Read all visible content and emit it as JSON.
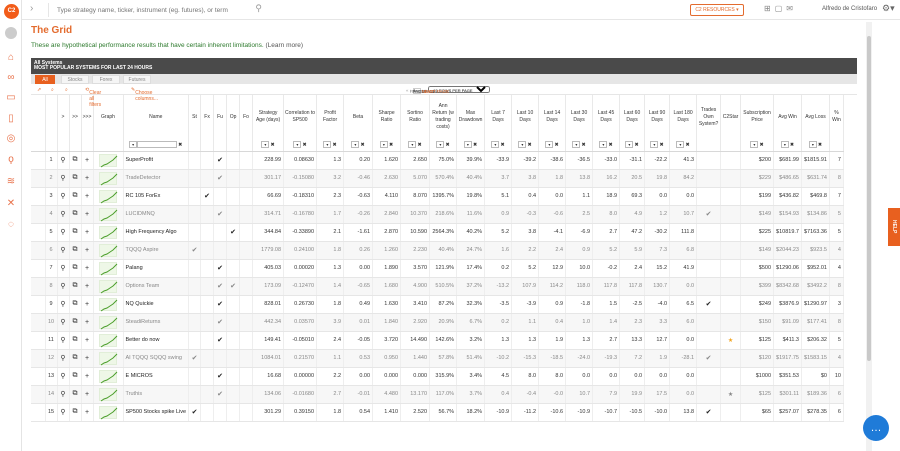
{
  "topbar": {
    "search_placeholder": "Type strategy name, ticker, instrument (eg. futures), or term",
    "resources_label": "C2 RESOURCES",
    "user_name": "Alfredo de Cristofaro"
  },
  "page": {
    "title": "The Grid",
    "disclaimer": "These are hypothetical performance results that have certain inherent limitations.",
    "learn_more": "(Learn more)"
  },
  "panel": {
    "title_line1": "All Systems",
    "title_line2": "MOST POPULAR SYSTEMS FOR LAST 24 HOURS"
  },
  "tabs": [
    "All",
    "Stocks",
    "Forex",
    "Futures"
  ],
  "toolbar": {
    "clear_filters": "Clear all filters",
    "choose_columns": "Choose columns...",
    "first_page": "FIRST PAGE",
    "previous": "PREVIOUS",
    "page_label": "PAGE",
    "page_value": "1",
    "of_pages": "OF 33",
    "next": "NEXT",
    "last_page": "LAST PAGE",
    "rows_per_page": "15 ROWS PER PAGE"
  },
  "columns": [
    "",
    ">",
    ">>",
    ">>>",
    "Graph",
    "Name",
    "St",
    "Fx",
    "Fu",
    "Op",
    "Fo",
    "Strategy Age (days)",
    "Correlation to SP500",
    "Profit Factor",
    "Beta",
    "Sharpe Ratio",
    "Sortino Ratio",
    "Ann Return (w trading costs)",
    "Max Drawdown",
    "Last 7 Days",
    "Last 10 Days",
    "Last 14 Days",
    "Last 30 Days",
    "Last 45 Days",
    "Last 60 Days",
    "Last 90 Days",
    "Last 180 Days",
    "Trades Own System?",
    "C2Star",
    "Subscription Price",
    "Avg Win",
    "Avg Loss",
    "% Win"
  ],
  "rows": [
    {
      "n": "1",
      "name": "SuperProfit",
      "st": "",
      "fx": "",
      "fu": "✔",
      "op": "",
      "fo": "",
      "age": "228.99",
      "corr": "0.08630",
      "pf": "1.3",
      "beta": "0.20",
      "sharpe": "1.620",
      "sortino": "2.650",
      "ann": "75.0%",
      "dd": "39.9%",
      "d7": "-33.9",
      "d10": "-39.2",
      "d14": "-38.6",
      "d30": "-36.5",
      "d45": "-33.0",
      "d60": "-31.1",
      "d90": "-22.2",
      "d180": "41.3",
      "own": "",
      "star": "",
      "price": "$200",
      "win": "$681.99",
      "loss": "$1815.91",
      "pw": "7",
      "muted": false
    },
    {
      "n": "2",
      "name": "TradeDetector",
      "st": "",
      "fx": "",
      "fu": "✔",
      "op": "",
      "fo": "",
      "age": "301.17",
      "corr": "-0.15080",
      "pf": "3.2",
      "beta": "-0.46",
      "sharpe": "2.630",
      "sortino": "5.070",
      "ann": "570.4%",
      "dd": "40.4%",
      "d7": "3.7",
      "d10": "3.8",
      "d14": "1.8",
      "d30": "13.8",
      "d45": "16.2",
      "d60": "20.5",
      "d90": "19.8",
      "d180": "84.2",
      "own": "",
      "star": "",
      "price": "$229",
      "win": "$486.65",
      "loss": "$631.74",
      "pw": "8",
      "muted": true
    },
    {
      "n": "3",
      "name": "RC 105 ForEx",
      "st": "",
      "fx": "✔",
      "op": "",
      "fu": "",
      "fo": "",
      "age": "66.69",
      "corr": "-0.18310",
      "pf": "2.3",
      "beta": "-0.63",
      "sharpe": "4.110",
      "sortino": "8.070",
      "ann": "1395.7%",
      "dd": "19.8%",
      "d7": "5.1",
      "d10": "0.4",
      "d14": "0.0",
      "d30": "1.1",
      "d45": "18.9",
      "d60": "69.3",
      "d90": "0.0",
      "d180": "0.0",
      "own": "",
      "star": "",
      "price": "$199",
      "win": "$436.82",
      "loss": "$469.8",
      "pw": "7",
      "muted": false
    },
    {
      "n": "4",
      "name": "LUCIDMNQ",
      "st": "",
      "fx": "",
      "fu": "✔",
      "op": "",
      "fo": "",
      "age": "314.71",
      "corr": "-0.16780",
      "pf": "1.7",
      "beta": "-0.26",
      "sharpe": "2.840",
      "sortino": "10.370",
      "ann": "218.6%",
      "dd": "11.6%",
      "d7": "0.9",
      "d10": "-0.3",
      "d14": "-0.6",
      "d30": "2.5",
      "d45": "8.0",
      "d60": "4.9",
      "d90": "1.2",
      "d180": "10.7",
      "own": "✔",
      "star": "",
      "price": "$149",
      "win": "$154.93",
      "loss": "$134.86",
      "pw": "5",
      "muted": true
    },
    {
      "n": "5",
      "name": "High Frequency Algo",
      "st": "",
      "fx": "",
      "fu": "",
      "op": "✔",
      "fo": "",
      "age": "344.84",
      "corr": "-0.33890",
      "pf": "2.1",
      "beta": "-1.61",
      "sharpe": "2.870",
      "sortino": "10.590",
      "ann": "2564.3%",
      "dd": "40.2%",
      "d7": "5.2",
      "d10": "3.8",
      "d14": "-4.1",
      "d30": "-6.9",
      "d45": "2.7",
      "d60": "47.2",
      "d90": "-30.2",
      "d180": "111.8",
      "own": "",
      "star": "",
      "price": "$225",
      "win": "$10819.7",
      "loss": "$7163.36",
      "pw": "5",
      "muted": false
    },
    {
      "n": "6",
      "name": "TQQQ Aspire",
      "st": "✔",
      "fx": "",
      "fu": "",
      "op": "",
      "fo": "",
      "age": "1779.08",
      "corr": "0.24100",
      "pf": "1.8",
      "beta": "0.26",
      "sharpe": "1.260",
      "sortino": "2.230",
      "ann": "40.4%",
      "dd": "24.7%",
      "d7": "1.6",
      "d10": "2.2",
      "d14": "2.4",
      "d30": "0.9",
      "d45": "5.2",
      "d60": "5.9",
      "d90": "7.3",
      "d180": "6.8",
      "own": "",
      "star": "",
      "price": "$149",
      "win": "$2044.23",
      "loss": "$923.5",
      "pw": "4",
      "muted": true
    },
    {
      "n": "7",
      "name": "Palang",
      "st": "",
      "fx": "",
      "fu": "✔",
      "op": "",
      "fo": "",
      "age": "405.03",
      "corr": "0.00020",
      "pf": "1.3",
      "beta": "0.00",
      "sharpe": "1.890",
      "sortino": "3.570",
      "ann": "121.9%",
      "dd": "17.4%",
      "d7": "0.2",
      "d10": "5.2",
      "d14": "12.9",
      "d30": "10.0",
      "d45": "-0.2",
      "d60": "2.4",
      "d90": "15.2",
      "d180": "41.9",
      "own": "",
      "star": "",
      "price": "$500",
      "win": "$1290.06",
      "loss": "$952.01",
      "pw": "4",
      "muted": false
    },
    {
      "n": "8",
      "name": "Options Team",
      "st": "",
      "fx": "",
      "fu": "✔",
      "op": "✔",
      "fo": "",
      "age": "173.09",
      "corr": "-0.12470",
      "pf": "1.4",
      "beta": "-0.65",
      "sharpe": "1.680",
      "sortino": "4.900",
      "ann": "510.5%",
      "dd": "37.2%",
      "d7": "-13.2",
      "d10": "107.9",
      "d14": "114.2",
      "d30": "118.0",
      "d45": "117.8",
      "d60": "117.8",
      "d90": "130.7",
      "d180": "0.0",
      "own": "",
      "star": "",
      "price": "$399",
      "win": "$8342.68",
      "loss": "$3492.2",
      "pw": "8",
      "muted": true
    },
    {
      "n": "9",
      "name": "NQ Quickie",
      "st": "",
      "fx": "",
      "fu": "✔",
      "op": "",
      "fo": "",
      "age": "828.01",
      "corr": "0.26730",
      "pf": "1.8",
      "beta": "0.49",
      "sharpe": "1.630",
      "sortino": "3.410",
      "ann": "87.2%",
      "dd": "32.3%",
      "d7": "-3.5",
      "d10": "-3.9",
      "d14": "0.9",
      "d30": "-1.8",
      "d45": "1.5",
      "d60": "-2.5",
      "d90": "-4.0",
      "d180": "6.5",
      "own": "✔",
      "star": "",
      "price": "$249",
      "win": "$3876.9",
      "loss": "$1290.97",
      "pw": "3",
      "muted": false
    },
    {
      "n": "10",
      "name": "SteadiReturns",
      "st": "",
      "fx": "",
      "fu": "✔",
      "op": "",
      "fo": "",
      "age": "442.34",
      "corr": "0.03570",
      "pf": "3.9",
      "beta": "0.01",
      "sharpe": "1.840",
      "sortino": "2.920",
      "ann": "20.9%",
      "dd": "6.7%",
      "d7": "0.2",
      "d10": "1.1",
      "d14": "0.4",
      "d30": "1.0",
      "d45": "1.4",
      "d60": "2.3",
      "d90": "3.3",
      "d180": "6.0",
      "own": "",
      "star": "",
      "price": "$150",
      "win": "$91.09",
      "loss": "$177.41",
      "pw": "8",
      "muted": true
    },
    {
      "n": "11",
      "name": "Better do now",
      "st": "",
      "fx": "",
      "fu": "✔",
      "op": "",
      "fo": "",
      "age": "149.41",
      "corr": "-0.05010",
      "pf": "2.4",
      "beta": "-0.05",
      "sharpe": "3.720",
      "sortino": "14.490",
      "ann": "142.6%",
      "dd": "3.2%",
      "d7": "1.3",
      "d10": "1.3",
      "d14": "1.9",
      "d30": "1.3",
      "d45": "2.7",
      "d60": "13.3",
      "d90": "12.7",
      "d180": "0.0",
      "own": "",
      "star": "★",
      "price": "$125",
      "win": "$411.3",
      "loss": "$206.32",
      "pw": "5",
      "muted": false
    },
    {
      "n": "12",
      "name": "AI TQQQ SQQQ swing",
      "st": "✔",
      "fx": "",
      "fu": "",
      "op": "",
      "fo": "",
      "age": "1084.01",
      "corr": "0.21570",
      "pf": "1.1",
      "beta": "0.53",
      "sharpe": "0.950",
      "sortino": "1.440",
      "ann": "57.8%",
      "dd": "51.4%",
      "d7": "-10.2",
      "d10": "-15.3",
      "d14": "-18.5",
      "d30": "-24.0",
      "d45": "-19.3",
      "d60": "7.2",
      "d90": "1.9",
      "d180": "-28.1",
      "own": "✔",
      "star": "",
      "price": "$120",
      "win": "$1917.75",
      "loss": "$1583.15",
      "pw": "4",
      "muted": true
    },
    {
      "n": "13",
      "name": "E MICROS",
      "st": "",
      "fx": "",
      "fu": "✔",
      "op": "",
      "fo": "",
      "age": "16.68",
      "corr": "0.00000",
      "pf": "2.2",
      "beta": "0.00",
      "sharpe": "0.000",
      "sortino": "0.000",
      "ann": "315.9%",
      "dd": "3.4%",
      "d7": "4.5",
      "d10": "8.0",
      "d14": "8.0",
      "d30": "0.0",
      "d45": "0.0",
      "d60": "0.0",
      "d90": "0.0",
      "d180": "0.0",
      "own": "",
      "star": "",
      "price": "$1000",
      "win": "$351.53",
      "loss": "$0",
      "pw": "10",
      "muted": false
    },
    {
      "n": "14",
      "name": "Truthis",
      "st": "",
      "fx": "",
      "fu": "✔",
      "op": "",
      "fo": "",
      "age": "134.06",
      "corr": "-0.01680",
      "pf": "2.7",
      "beta": "-0.01",
      "sharpe": "4.480",
      "sortino": "13.170",
      "ann": "117.0%",
      "dd": "3.7%",
      "d7": "0.4",
      "d10": "-0.4",
      "d14": "-0.0",
      "d30": "10.7",
      "d45": "7.9",
      "d60": "19.9",
      "d90": "17.5",
      "d180": "0.0",
      "own": "",
      "star": "★",
      "price": "$125",
      "win": "$301.11",
      "loss": "$189.36",
      "pw": "6",
      "muted": true
    },
    {
      "n": "15",
      "name": "SP500 Stocks spike Live",
      "st": "✔",
      "fx": "",
      "fu": "",
      "op": "",
      "fo": "",
      "age": "301.29",
      "corr": "0.39150",
      "pf": "1.8",
      "beta": "0.54",
      "sharpe": "1.410",
      "sortino": "2.520",
      "ann": "56.7%",
      "dd": "18.2%",
      "d7": "-10.9",
      "d10": "-11.2",
      "d14": "-10.6",
      "d30": "-10.9",
      "d45": "-10.7",
      "d60": "-10.5",
      "d90": "-10.0",
      "d180": "13.8",
      "own": "✔",
      "star": "",
      "price": "$65",
      "win": "$257.07",
      "loss": "$278.35",
      "pw": "6",
      "muted": false
    }
  ],
  "help_label": "HELP"
}
